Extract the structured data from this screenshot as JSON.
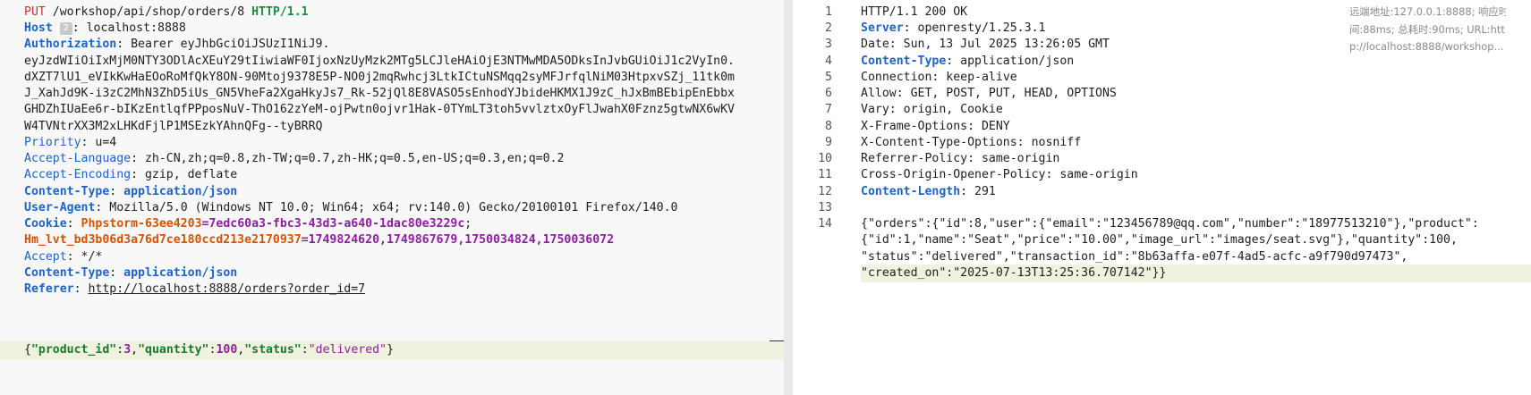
{
  "request": {
    "method": "PUT",
    "path": " /workshop/api/shop/orders/8 ",
    "protocol": "HTTP/1.1",
    "host_badge": "2",
    "headers": [
      {
        "name": "Host",
        "sep": ": ",
        "value": "localhost:8888"
      },
      {
        "name": "Authorization",
        "sep": ": ",
        "value": "Bearer eyJhbGciOiJSUzI1NiJ9."
      },
      {
        "name": "Priority",
        "sep": ": ",
        "value": "u=4"
      },
      {
        "name": "Accept-Language",
        "sep": ": ",
        "value": "zh-CN,zh;q=0.8,zh-TW;q=0.7,zh-HK;q=0.5,en-US;q=0.3,en;q=0.2"
      },
      {
        "name": "Accept-Encoding",
        "sep": ": ",
        "value": "gzip, deflate"
      },
      {
        "name": "Content-Type",
        "sep": ": ",
        "value": "application/json"
      },
      {
        "name": "User-Agent",
        "sep": ": ",
        "value": "Mozilla/5.0 (Windows NT 10.0; Win64; x64; rv:140.0) Gecko/20100101 Firefox/140.0"
      },
      {
        "name": "Cookie",
        "sep": ": "
      },
      {
        "name": "Accept",
        "sep": ": ",
        "value": "*/*"
      },
      {
        "name": "Content-Type",
        "sep": ": ",
        "value": "application/json"
      },
      {
        "name": "Referer",
        "sep": ": ",
        "value": "http://localhost:8888/orders?order_id=7"
      }
    ],
    "token_lines": [
      "eyJzdWIiOiIxMjM0NTY3ODlAcXEuY29tIiwiaWF0IjoxNzUyMzk2MTg5LCJleHAiOjE3NTMwMDA5ODksInJvbGUiOiJ1c2VyIn0.",
      "dXZT7lU1_eVIkKwHaEOoRoMfQkY8ON-90Mtoj9378E5P-NO0j2mqRwhcj3LtkICtuNSMqq2syMFJrfqlNiM03HtpxvSZj_11tk0m",
      "J_XahJd9K-i3zC2MhN3ZhD5iUs_GN5VheFa2XgaHkyJs7_Rk-52jQl8E8VASO5sEnhodYJbideHKMX1J9zC_hJxBmBEbipEnEbbx",
      "GHDZhIUaEe6r-bIKzEntlqfPPposNuV-ThO162zYeM-ojPwtn0ojvr1Hak-0TYmLT3toh5vvlztxOyFlJwahX0Fznz5gtwNX6wKV",
      "W4TVNtrXX3M2xLHKdFjlP1MSEzkYAhnQFg--tyBRRQ"
    ],
    "cookies": [
      {
        "name": "Phpstorm-63ee4203",
        "value": "7edc60a3-fbc3-43d3-a640-1dac80e3229c",
        "sep": "; "
      },
      {
        "name": "Hm_lvt_bd3b06d3a76d7ce180ccd213e2170937",
        "value": "1749824620,1749867679,1750034824,1750036072",
        "sep": ""
      }
    ],
    "body": {
      "open": "{",
      "k1": "\"product_id\"",
      "v1": "3",
      "k2": "\"quantity\"",
      "v2": "100",
      "k3": "\"status\"",
      "v3": "\"delivered\"",
      "close": "}"
    }
  },
  "response": {
    "line_numbers": [
      "1",
      "2",
      "3",
      "4",
      "5",
      "6",
      "7",
      "8",
      "9",
      "10",
      "11",
      "12",
      "13",
      "14"
    ],
    "status_line": "HTTP/1.1 200 OK",
    "headers": [
      {
        "name": "Server",
        "value": "openresty/1.25.3.1",
        "bold": true
      },
      {
        "name": "Date",
        "value": "Sun, 13 Jul 2025 13:26:05 GMT",
        "bold": false
      },
      {
        "name": "Content-Type",
        "value": "application/json",
        "bold": true
      },
      {
        "name": "Connection",
        "value": "keep-alive",
        "bold": false
      },
      {
        "name": "Allow",
        "value": "GET, POST, PUT, HEAD, OPTIONS",
        "bold": false
      },
      {
        "name": "Vary",
        "value": "origin, Cookie",
        "bold": false
      },
      {
        "name": "X-Frame-Options",
        "value": "DENY",
        "bold": false
      },
      {
        "name": "X-Content-Type-Options",
        "value": "nosniff",
        "bold": false
      },
      {
        "name": "Referrer-Policy",
        "value": "same-origin",
        "bold": false
      },
      {
        "name": "Cross-Origin-Opener-Policy",
        "value": "same-origin",
        "bold": false
      },
      {
        "name": "Content-Length",
        "value": "291",
        "bold": true
      }
    ],
    "body_lines": [
      "{\"orders\":{\"id\":8,\"user\":{\"email\":\"123456789@qq.com\",\"number\":\"18977513210\"},\"product\":",
      "{\"id\":1,\"name\":\"Seat\",\"price\":\"10.00\",\"image_url\":\"images/seat.svg\"},\"quantity\":100,",
      "\"status\":\"delivered\",\"transaction_id\":\"8b63affa-e07f-4ad5-acfc-a9f790d97473\",",
      "\"created_on\":\"2025-07-13T13:25:36.707142\"}}"
    ]
  },
  "meta": {
    "line1": "远端地址:127.0.0.1:8888; 响应时",
    "line2": "间:88ms; 总耗时:90ms; URL:htt",
    "line3": "p://localhost:8888/workshop..."
  }
}
